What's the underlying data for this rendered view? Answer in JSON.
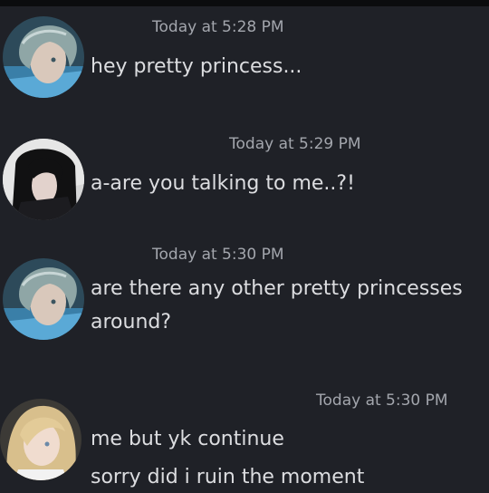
{
  "messages": [
    {
      "avatar": "avatar-silver-haired-man",
      "timestamp": "Today at 5:28 PM",
      "lines": [
        "hey pretty princess..."
      ]
    },
    {
      "avatar": "avatar-dark-haired-person",
      "timestamp": "Today at 5:29 PM",
      "lines": [
        "a-are you talking to me..?!"
      ]
    },
    {
      "avatar": "avatar-silver-haired-man",
      "timestamp": "Today at 5:30 PM",
      "lines": [
        "are there any other pretty princesses",
        "around?"
      ]
    },
    {
      "avatar": "avatar-blonde-woman",
      "timestamp": "Today at 5:30 PM",
      "lines": [
        "me but yk continue",
        "sorry did i ruin the moment"
      ]
    }
  ],
  "colors": {
    "background": "#1f2127",
    "text": "#dcdde0",
    "timestamp": "#a3a6ad"
  }
}
